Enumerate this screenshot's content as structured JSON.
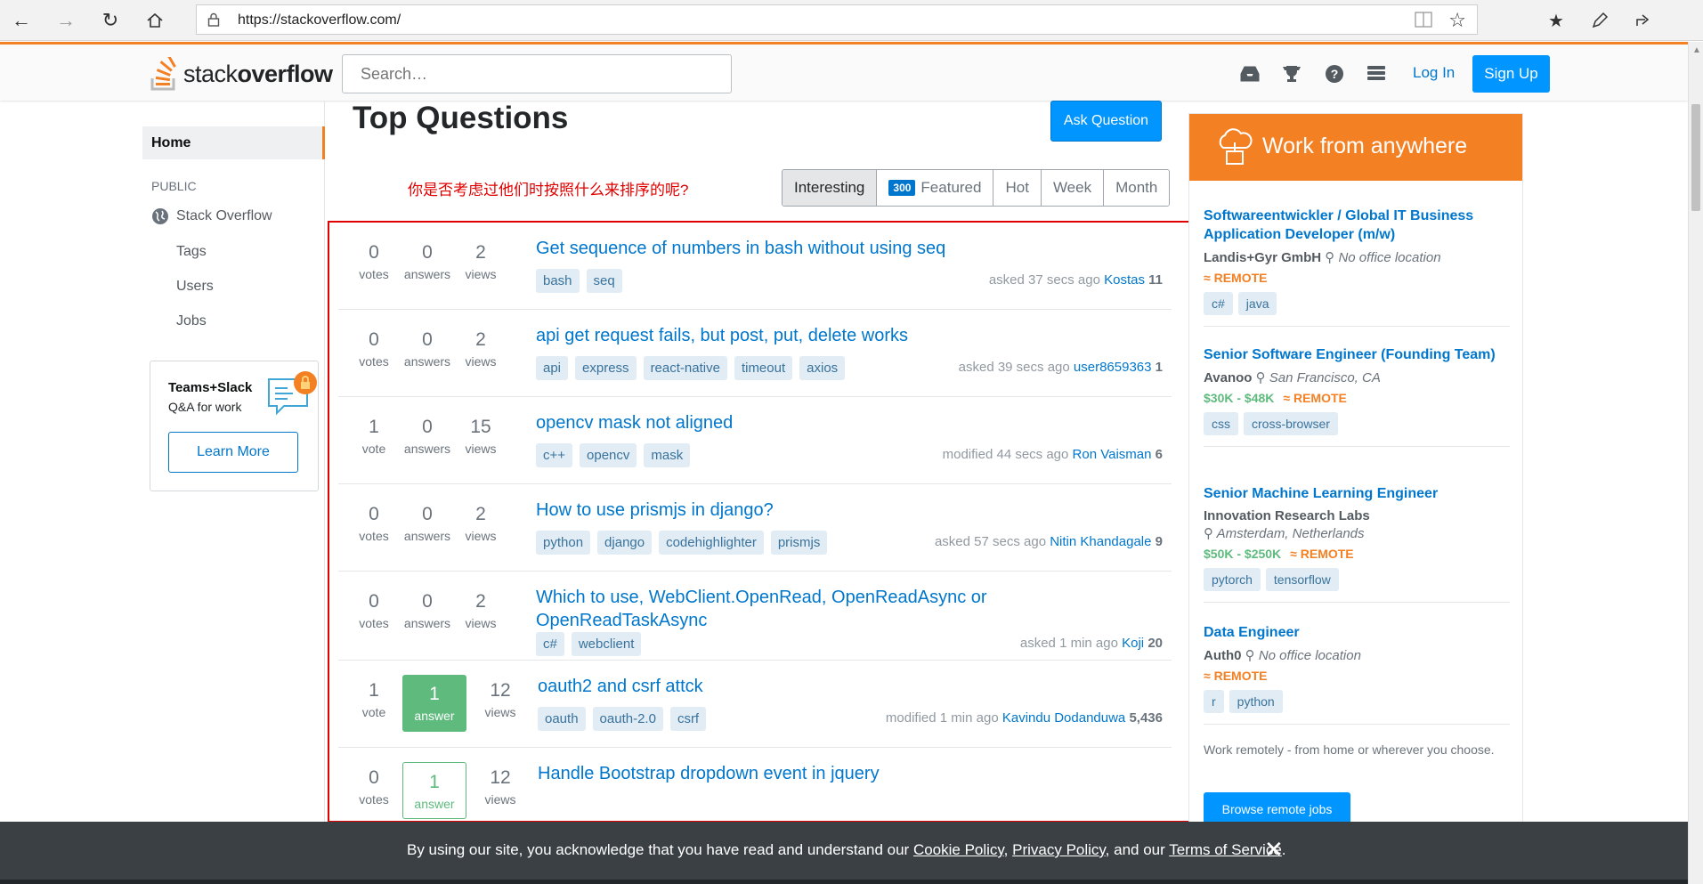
{
  "browser": {
    "url": "https://stackoverflow.com/"
  },
  "header": {
    "logo_light": "stack",
    "logo_bold": "overflow",
    "search_placeholder": "Search…",
    "login_label": "Log In",
    "signup_label": "Sign Up"
  },
  "sidebar": {
    "home": "Home",
    "public_label": "PUBLIC",
    "stack_overflow": "Stack Overflow",
    "links": [
      "Tags",
      "Users",
      "Jobs"
    ],
    "teams_title": "Teams+Slack",
    "teams_sub": "Q&A for work",
    "learn_more": "Learn More"
  },
  "main": {
    "title": "Top Questions",
    "ask_button": "Ask Question",
    "annotation": "你是否考虑过他们时按照什么来排序的呢?",
    "filters": {
      "interesting": "Interesting",
      "featured_count": "300",
      "featured": "Featured",
      "hot": "Hot",
      "week": "Week",
      "month": "Month"
    },
    "questions": [
      {
        "votes": "0",
        "votes_label": "votes",
        "answers": "0",
        "answers_label": "answers",
        "views": "2",
        "views_label": "views",
        "title": "Get sequence of numbers in bash without using seq",
        "tags": [
          "bash",
          "seq"
        ],
        "action": "asked 37 secs ago",
        "user": "Kostas",
        "rep": "11"
      },
      {
        "votes": "0",
        "votes_label": "votes",
        "answers": "0",
        "answers_label": "answers",
        "views": "2",
        "views_label": "views",
        "title": "api get request fails, but post, put, delete works",
        "tags": [
          "api",
          "express",
          "react-native",
          "timeout",
          "axios"
        ],
        "action": "asked 39 secs ago",
        "user": "user8659363",
        "rep": "1"
      },
      {
        "votes": "1",
        "votes_label": "vote",
        "answers": "0",
        "answers_label": "answers",
        "views": "15",
        "views_label": "views",
        "title": "opencv mask not aligned",
        "tags": [
          "c++",
          "opencv",
          "mask"
        ],
        "action": "modified 44 secs ago",
        "user": "Ron Vaisman",
        "rep": "6"
      },
      {
        "votes": "0",
        "votes_label": "votes",
        "answers": "0",
        "answers_label": "answers",
        "views": "2",
        "views_label": "views",
        "title": "How to use prismjs in django?",
        "tags": [
          "python",
          "django",
          "codehighlighter",
          "prismjs"
        ],
        "action": "asked 57 secs ago",
        "user": "Nitin Khandagale",
        "rep": "9"
      },
      {
        "votes": "0",
        "votes_label": "votes",
        "answers": "0",
        "answers_label": "answers",
        "views": "2",
        "views_label": "views",
        "title": "Which to use, WebClient.OpenRead, OpenReadAsync or OpenReadTaskAsync",
        "tags": [
          "c#",
          "webclient"
        ],
        "action": "asked 1 min ago",
        "user": "Koji",
        "rep": "20"
      },
      {
        "votes": "1",
        "votes_label": "vote",
        "answers": "1",
        "answers_label": "answer",
        "views": "12",
        "views_label": "views",
        "title": "oauth2 and csrf attck",
        "tags": [
          "oauth",
          "oauth-2.0",
          "csrf"
        ],
        "action": "modified 1 min ago",
        "user": "Kavindu Dodanduwa",
        "rep": "5,436"
      },
      {
        "votes": "0",
        "votes_label": "votes",
        "answers": "1",
        "answers_label": "answer",
        "views": "12",
        "views_label": "views",
        "title": "Handle Bootstrap dropdown event in jquery",
        "tags": [],
        "action": "",
        "user": "",
        "rep": ""
      }
    ]
  },
  "jobs": {
    "header": "Work from anywhere",
    "items": [
      {
        "title": "Softwareentwickler / Global IT Business Application Developer (m/w)",
        "company": "Landis+Gyr GmbH",
        "location": "No office location",
        "salary": "",
        "remote": "REMOTE",
        "tags": [
          "c#",
          "java"
        ]
      },
      {
        "title": "Senior Software Engineer (Founding Team)",
        "company": "Avanoo",
        "location": "San Francisco, CA",
        "salary": "$30K - $48K",
        "remote": "REMOTE",
        "tags": [
          "css",
          "cross-browser"
        ]
      },
      {
        "title": "Senior Machine Learning Engineer",
        "company": "Innovation Research Labs",
        "location": "Amsterdam, Netherlands",
        "salary": "$50K - $250K",
        "remote": "REMOTE",
        "tags": [
          "pytorch",
          "tensorflow"
        ]
      },
      {
        "title": "Data Engineer",
        "company": "Auth0",
        "location": "No office location",
        "salary": "",
        "remote": "REMOTE",
        "tags": [
          "r",
          "python"
        ]
      }
    ],
    "footer": "Work remotely - from home or wherever you choose.",
    "browse": "Browse remote jobs"
  },
  "cookie": {
    "prefix": "By using our site, you acknowledge that you have read and understand our ",
    "cookie_policy": "Cookie Policy",
    "sep1": ", ",
    "privacy_policy": "Privacy Policy",
    "sep2": ", and our ",
    "terms": "Terms of Service",
    "suffix": "."
  },
  "colors": {
    "accent": "#f48024",
    "link": "#0077cc",
    "primary_button": "#0095ff",
    "annotation_red": "#e00000",
    "answered_green": "#5eba7d"
  }
}
